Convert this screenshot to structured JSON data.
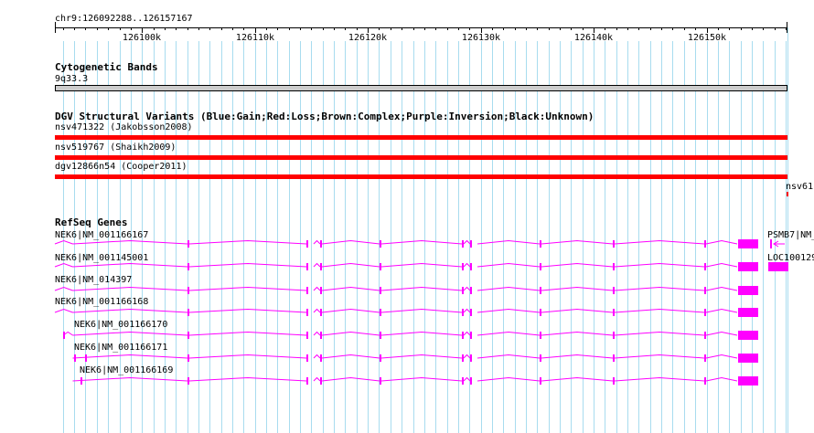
{
  "region": {
    "label": "chr9:126092288..126157167",
    "start": 126092288,
    "end": 126157167
  },
  "ruler": {
    "ticks": [
      {
        "pos": 126100000,
        "label": "126100k"
      },
      {
        "pos": 126110000,
        "label": "126110k"
      },
      {
        "pos": 126120000,
        "label": "126120k"
      },
      {
        "pos": 126130000,
        "label": "126130k"
      },
      {
        "pos": 126140000,
        "label": "126140k"
      },
      {
        "pos": 126150000,
        "label": "126150k"
      }
    ]
  },
  "tracks": {
    "cytobands": {
      "title": "Cytogenetic Bands",
      "band_label": "9q33.3",
      "color": "#cccccc"
    },
    "dgv": {
      "title": "DGV Structural Variants (Blue:Gain;Red:Loss;Brown:Complex;Purple:Inversion;Black:Unknown)",
      "loss_color": "#ff0000",
      "features": [
        {
          "label": "nsv471322 (Jakobsson2008)"
        },
        {
          "label": "nsv519767 (Shaikh2009)"
        },
        {
          "label": "dgv12866n54 (Cooper2011)"
        }
      ],
      "clipped_feature": {
        "label": "nsv61"
      }
    },
    "refseq": {
      "title": "RefSeq Genes",
      "color": "#ff00ff",
      "transcripts": [
        {
          "label": "NEK6|NM_001166167"
        },
        {
          "label": "NEK6|NM_001145001"
        },
        {
          "label": "NEK6|NM_014397"
        },
        {
          "label": "NEK6|NM_001166168"
        },
        {
          "label": "NEK6|NM_001166170"
        },
        {
          "label": "NEK6|NM_001166171"
        },
        {
          "label": "NEK6|NM_001166169"
        }
      ],
      "neighbors": [
        {
          "label": "PSMB7|NM_"
        },
        {
          "label": "LOC100129"
        }
      ]
    }
  },
  "colors": {
    "grid": "#a8dcef",
    "axis": "#000000"
  }
}
